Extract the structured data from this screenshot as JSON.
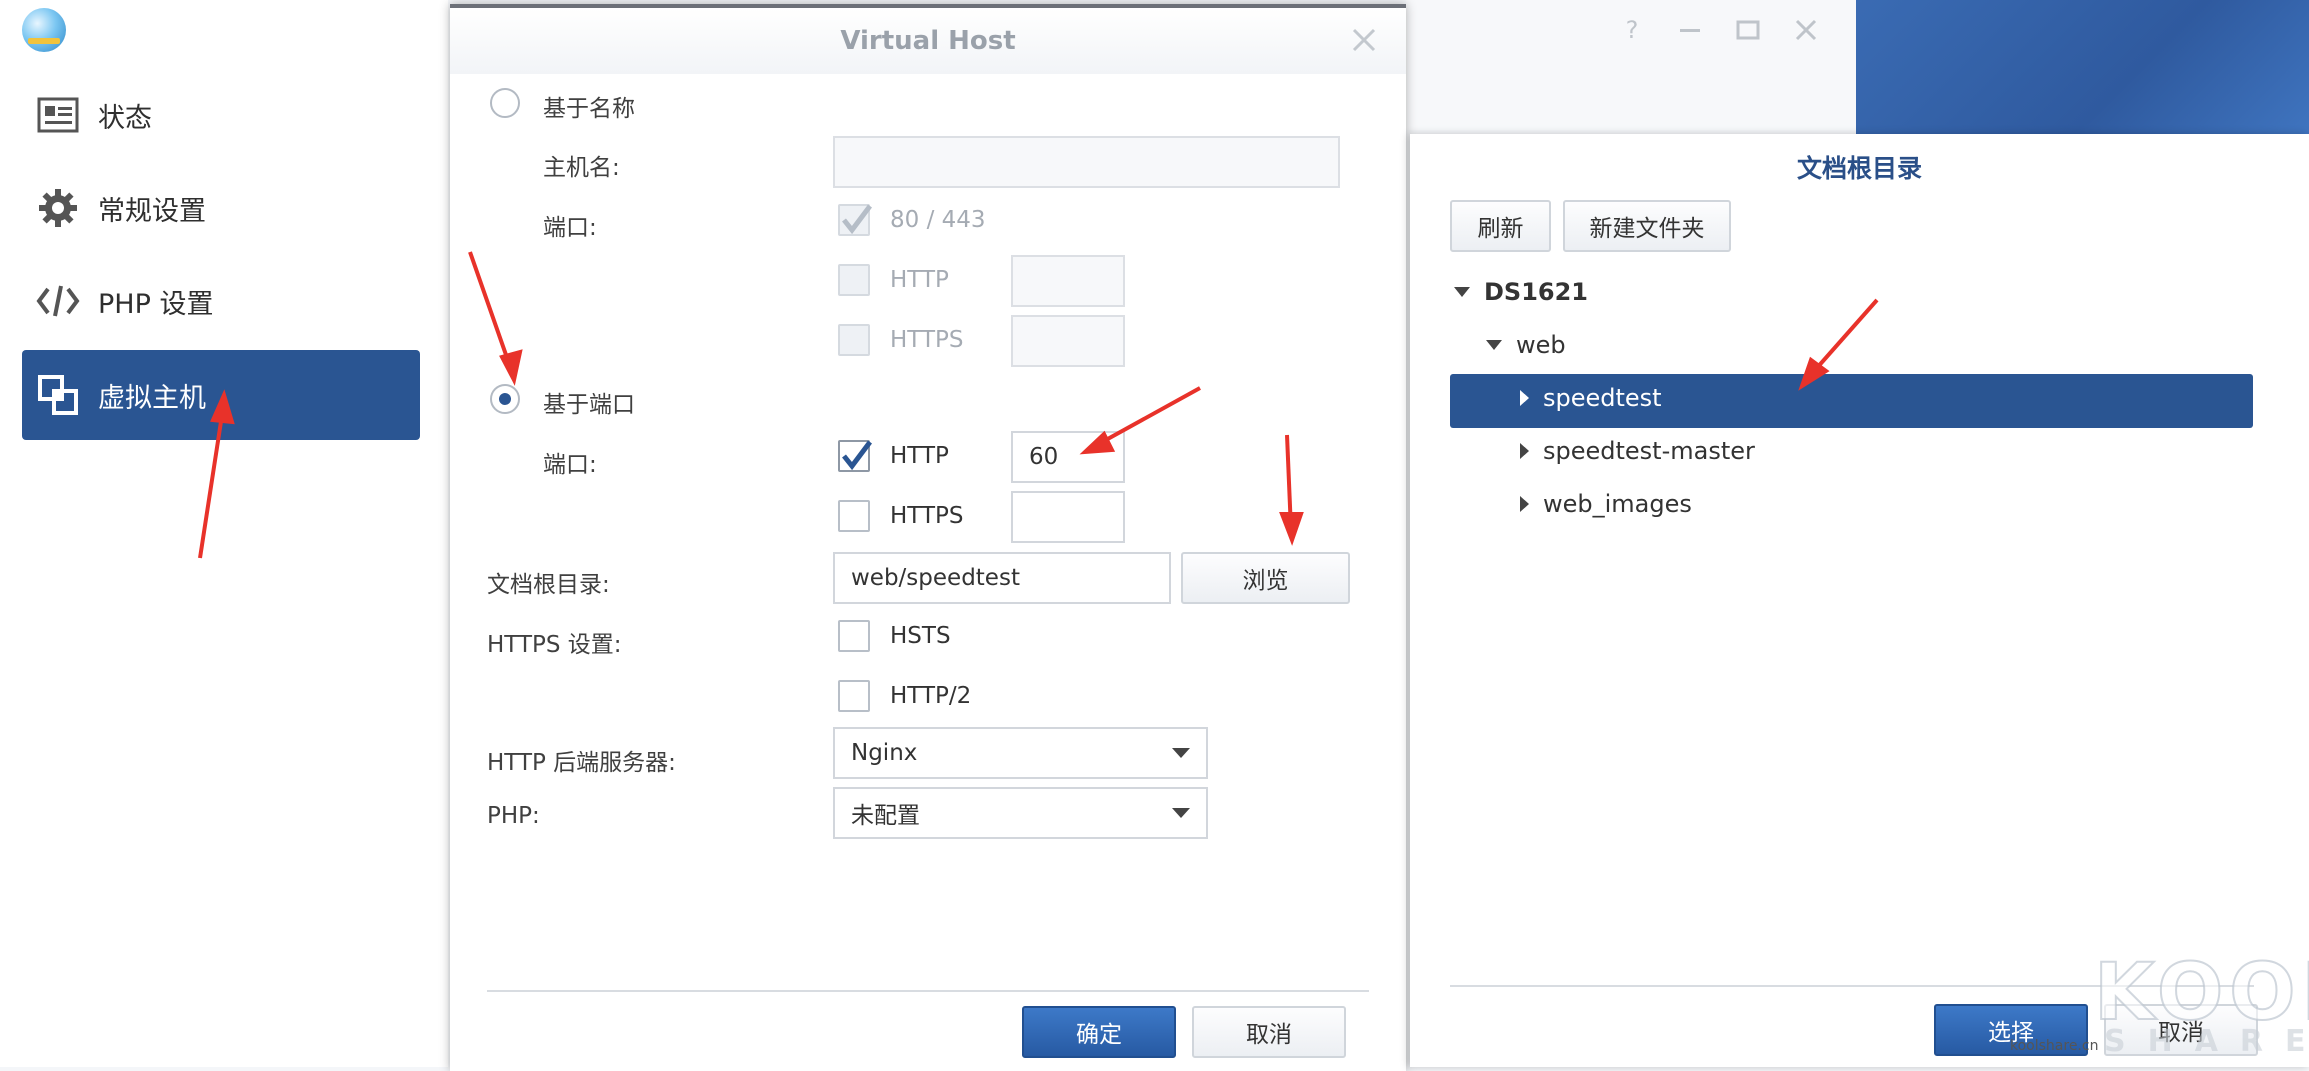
{
  "sidebar": {
    "items": [
      {
        "label": "状态"
      },
      {
        "label": "常规设置"
      },
      {
        "label": "PHP 设置"
      },
      {
        "label": "虚拟主机"
      }
    ]
  },
  "dialog": {
    "title": "Virtual Host",
    "by_name": {
      "label": "基于名称",
      "hostname_label": "主机名:",
      "hostname_value": "",
      "port_label": "端口:",
      "port_default": "80 / 443",
      "http_label": "HTTP",
      "http_value": "",
      "https_label": "HTTPS",
      "https_value": ""
    },
    "by_port": {
      "label": "基于端口",
      "port_label": "端口:",
      "http_label": "HTTP",
      "http_value": "60",
      "https_label": "HTTPS",
      "https_value": ""
    },
    "docroot_label": "文档根目录:",
    "docroot_value": "web/speedtest",
    "browse_label": "浏览",
    "https_settings_label": "HTTPS 设置:",
    "hsts_label": "HSTS",
    "http2_label": "HTTP/2",
    "backend_label": "HTTP 后端服务器:",
    "backend_value": "Nginx",
    "php_label": "PHP:",
    "php_value": "未配置",
    "ok_label": "确定",
    "cancel_label": "取消"
  },
  "picker": {
    "title": "文档根目录",
    "refresh_label": "刷新",
    "new_folder_label": "新建文件夹",
    "tree": [
      {
        "label": "DS1621",
        "level": 0,
        "expanded": true
      },
      {
        "label": "web",
        "level": 1,
        "expanded": true
      },
      {
        "label": "speedtest",
        "level": 2,
        "selected": true
      },
      {
        "label": "speedtest-master",
        "level": 2
      },
      {
        "label": "web_images",
        "level": 2
      }
    ],
    "select_label": "选择",
    "cancel_label": "取消"
  },
  "watermark": {
    "text": "KOOL",
    "sub": "SHARE",
    "url": "koolshare.cn"
  },
  "colors": {
    "accent": "#2a5592",
    "annotation_arrow": "#e8322a",
    "primary_button": "#2f67b4"
  },
  "icons": [
    "status-icon",
    "gear-icon",
    "code-icon",
    "virtual-host-icon",
    "close-icon",
    "help-icon",
    "minimize-icon",
    "maximize-icon",
    "checkmark-icon",
    "dropdown-caret-icon",
    "triangle-down-icon",
    "triangle-right-icon"
  ]
}
